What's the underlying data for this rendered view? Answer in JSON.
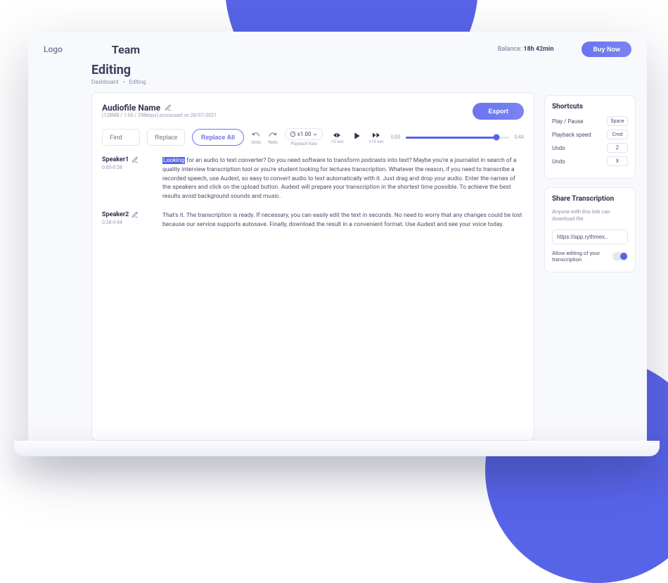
{
  "header": {
    "logo": "Logo",
    "title": "Team",
    "balance_label": "Balance:",
    "balance_value": "18h 42min",
    "buy_label": "Buy Now"
  },
  "page": {
    "heading": "Editing",
    "breadcrumb": [
      "Dashboard",
      "Editing"
    ]
  },
  "file": {
    "name": "Audiofile Name",
    "meta": "(128MB / 1:00 / 298kbps) processed on 28/07/2021",
    "export_label": "Export"
  },
  "controls": {
    "find_placeholder": "Find",
    "replace_placeholder": "Replace",
    "replace_all_label": "Replace All",
    "undo_label": "Undo",
    "redo_label": "Redo",
    "rate_value": "x1.00",
    "rate_label": "Playback Rate",
    "back_label": "-10 sec",
    "fwd_label": "+10 sec",
    "time_start": "0:00",
    "time_end": "0:44"
  },
  "transcript": [
    {
      "speaker": "Speaker1",
      "time": "0:00-0:38",
      "highlight": "Looking",
      "rest": " for an audio to text converter? Do you need software to transform podcasts into text? Maybe you're a journalist in search of a quality interview transcription tool or you're student looking for lectures transcription. Whatever the reason, if you need to transcribe a recorded speech, use Audext, so easy to convert audio to text automatically with it. Just drag and drop your audio. Enter the names of the speakers and click on the upload button. Audext will prepare your transcription in the shortest time possible. To achieve the best results avoid background sounds and music."
    },
    {
      "speaker": "Speaker2",
      "time": "0:38-0:44",
      "highlight": "",
      "rest": "That's it. The transcription is ready. If necessary, you can easily edit the text in seconds. No need to worry that any changes could be lost because our service supports autosave. Finally, download the result in a convenient format. Use Audext and see your voice today."
    }
  ],
  "shortcuts": {
    "title": "Shortcuts",
    "rows": [
      {
        "label": "Play / Pause",
        "key": "Space"
      },
      {
        "label": "Playback speed",
        "key": "Cmd"
      },
      {
        "label": "Undo",
        "key": "Z"
      },
      {
        "label": "Undo",
        "key": "X"
      }
    ]
  },
  "share": {
    "title": "Share Transcription",
    "subtitle": "Anyone with this link can download file",
    "link": "https://app.rythmex..",
    "toggle_label": "Allow editing of your transcription"
  }
}
